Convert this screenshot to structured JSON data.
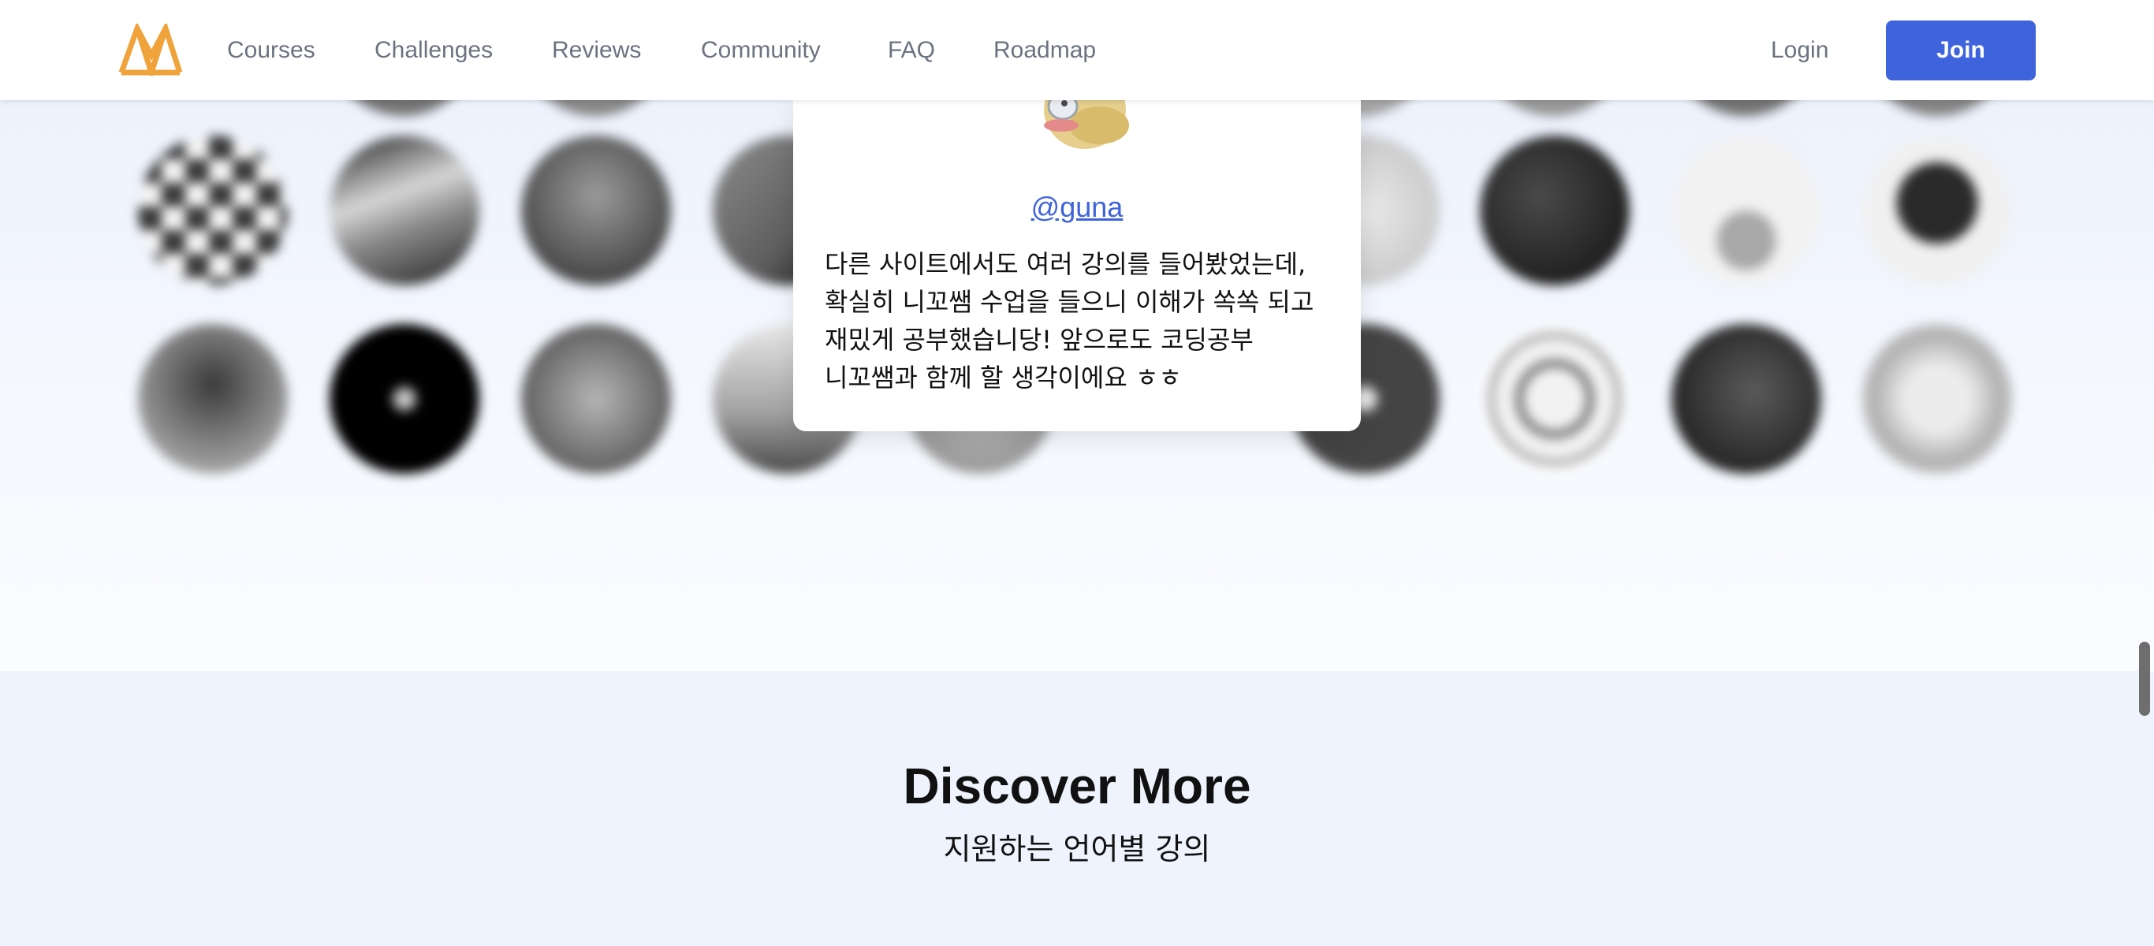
{
  "header": {
    "logo_icon": "brand-logo-icon",
    "nav": [
      {
        "label": "Courses"
      },
      {
        "label": "Challenges"
      },
      {
        "label": "Reviews"
      },
      {
        "label": "Community"
      },
      {
        "label": "FAQ"
      },
      {
        "label": "Roadmap"
      }
    ],
    "login_label": "Login",
    "join_label": "Join"
  },
  "review_card": {
    "author": "@guna",
    "lines": [
      "다른 사이트에서도 여러 강의를 들어봤었는데,",
      "확실히 니꼬쌤 수업을 들으니 이해가 쏙쏙 되고",
      "재밌게 공부했습니당! 앞으로도 코딩공부",
      "니꼬쌤과 함께 할 생각이에요 ㅎㅎ"
    ]
  },
  "discover": {
    "title": "Discover More",
    "subtitle": "지원하는 언어별 강의"
  },
  "colors": {
    "accent": "#3e63dd",
    "logo": "#f0a23b",
    "nav_text": "#6b7280",
    "section_bg": "#eef3fd"
  }
}
